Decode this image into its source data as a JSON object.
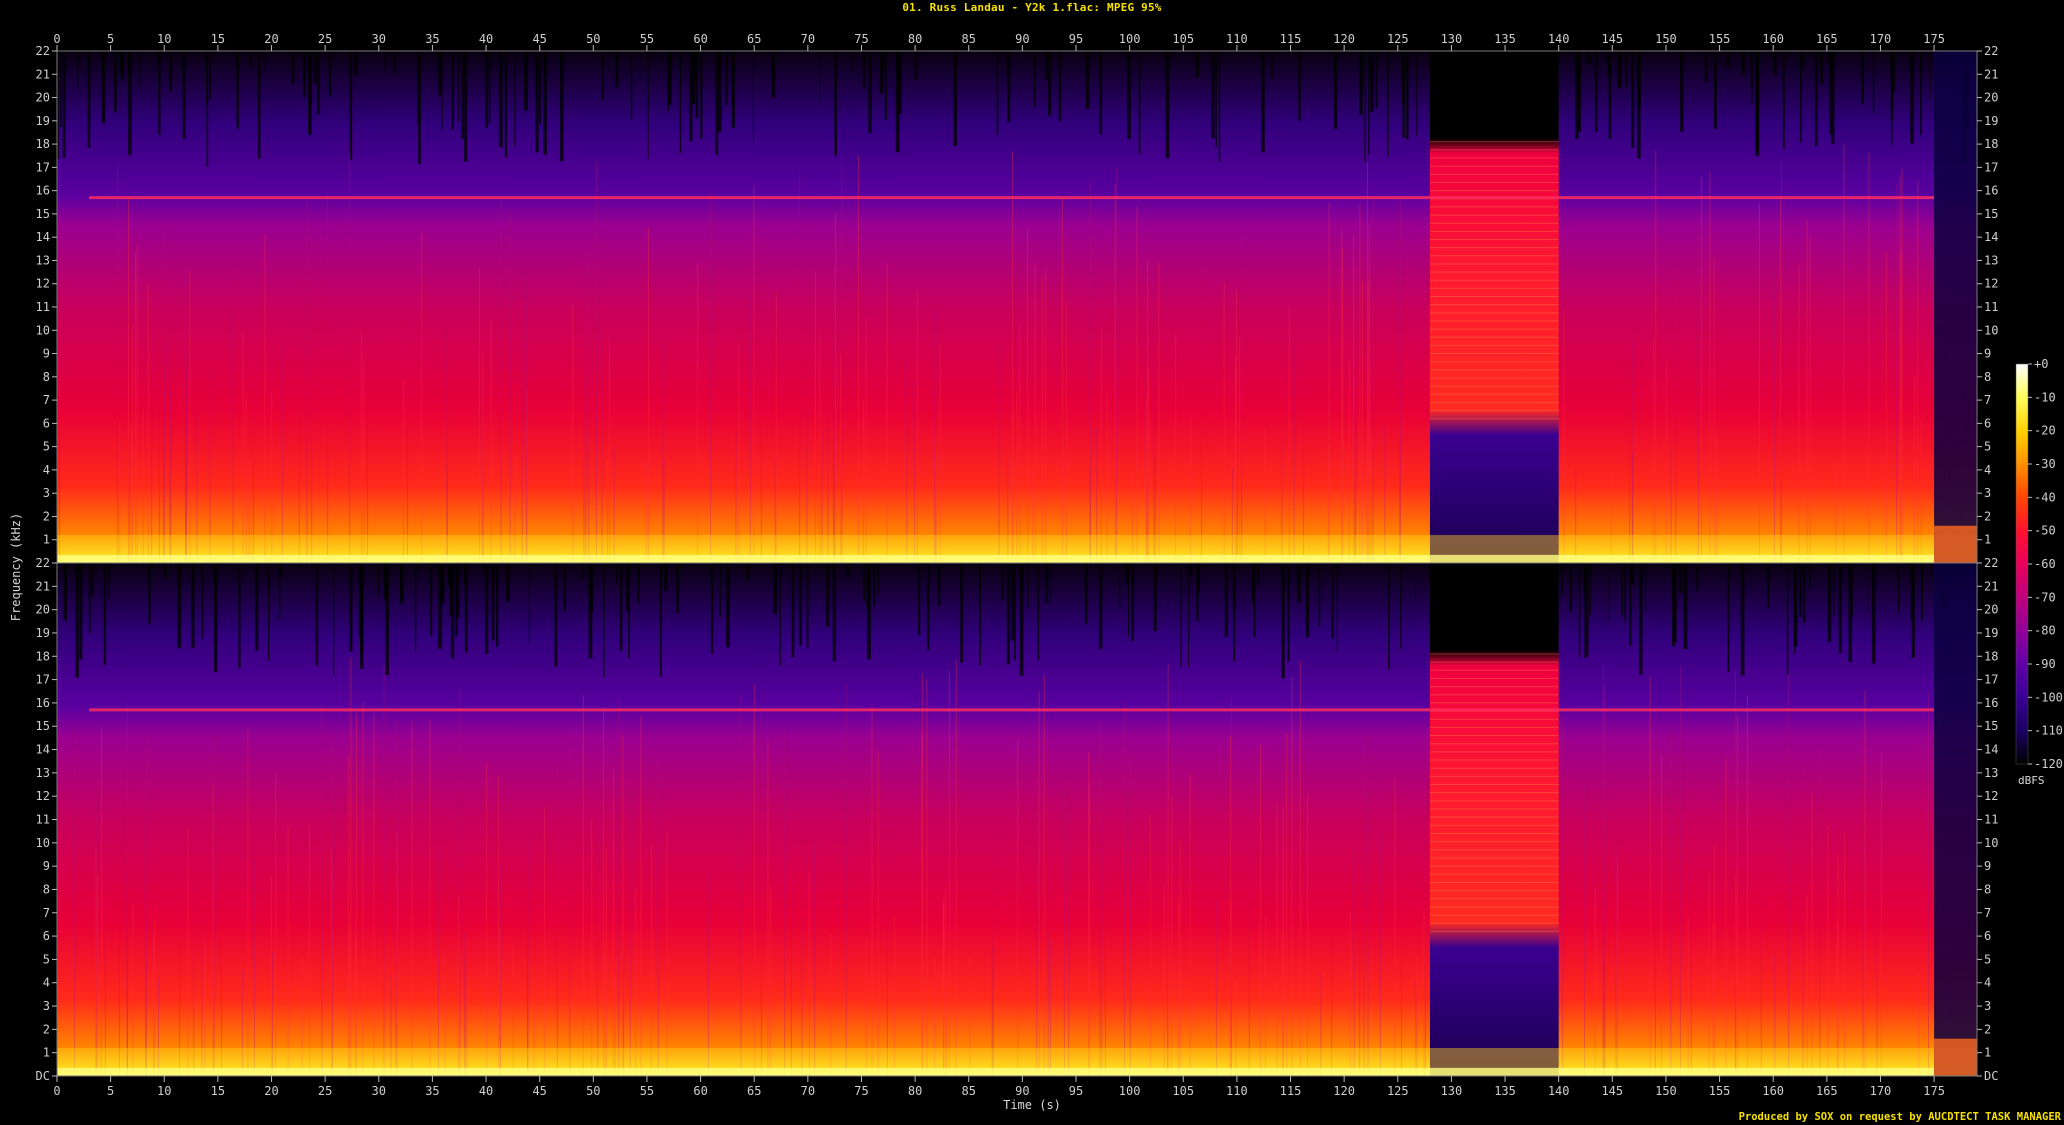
{
  "title": "01. Russ Landau - Y2k 1.flac: MPEG 95%",
  "credit": "Produced by SOX on request by AUCDTECT TASK MANAGER",
  "chart_data": {
    "type": "heatmap",
    "title": "01. Russ Landau - Y2k 1.flac: MPEG 95%",
    "xlabel": "Time (s)",
    "ylabel": "Frequency (kHz)",
    "xlim": [
      0,
      179
    ],
    "ylim": [
      0,
      22
    ],
    "x_ticks": [
      "0",
      "5",
      "10",
      "15",
      "20",
      "25",
      "30",
      "35",
      "40",
      "45",
      "50",
      "55",
      "60",
      "65",
      "70",
      "75",
      "80",
      "85",
      "90",
      "95",
      "100",
      "105",
      "110",
      "115",
      "120",
      "125",
      "130",
      "135",
      "140",
      "145",
      "150",
      "155",
      "160",
      "165",
      "170",
      "175"
    ],
    "y_ticks_top": [
      "22",
      "21",
      "20",
      "19",
      "18",
      "17",
      "16",
      "15",
      "14",
      "13",
      "12",
      "11",
      "10",
      "9",
      "8",
      "7",
      "6",
      "5",
      "4",
      "3",
      "2",
      "1"
    ],
    "y_ticks_bottom": [
      "22",
      "21",
      "20",
      "19",
      "18",
      "17",
      "16",
      "15",
      "14",
      "13",
      "12",
      "11",
      "10",
      "9",
      "8",
      "7",
      "6",
      "5",
      "4",
      "3",
      "2",
      "1",
      "DC"
    ],
    "channels": 2,
    "colorbar": {
      "label": "dBFS",
      "range": [
        -120,
        0
      ],
      "ticks": [
        "+0",
        "-10",
        "-20",
        "-30",
        "-40",
        "-50",
        "-60",
        "-70",
        "-80",
        "-90",
        "-100",
        "-110",
        "-120"
      ],
      "colors": [
        "#ffffff",
        "#ffff60",
        "#ffd000",
        "#ff9000",
        "#ff4800",
        "#ff1030",
        "#e8005a",
        "#c0007c",
        "#90009a",
        "#6000a8",
        "#3a0098",
        "#1a0060",
        "#000000"
      ]
    },
    "features": {
      "cutoff_khz": 15.7,
      "bright_band_time": [
        128,
        140
      ],
      "bright_band_top_khz": 18.2,
      "fade_out_start": 175
    }
  }
}
